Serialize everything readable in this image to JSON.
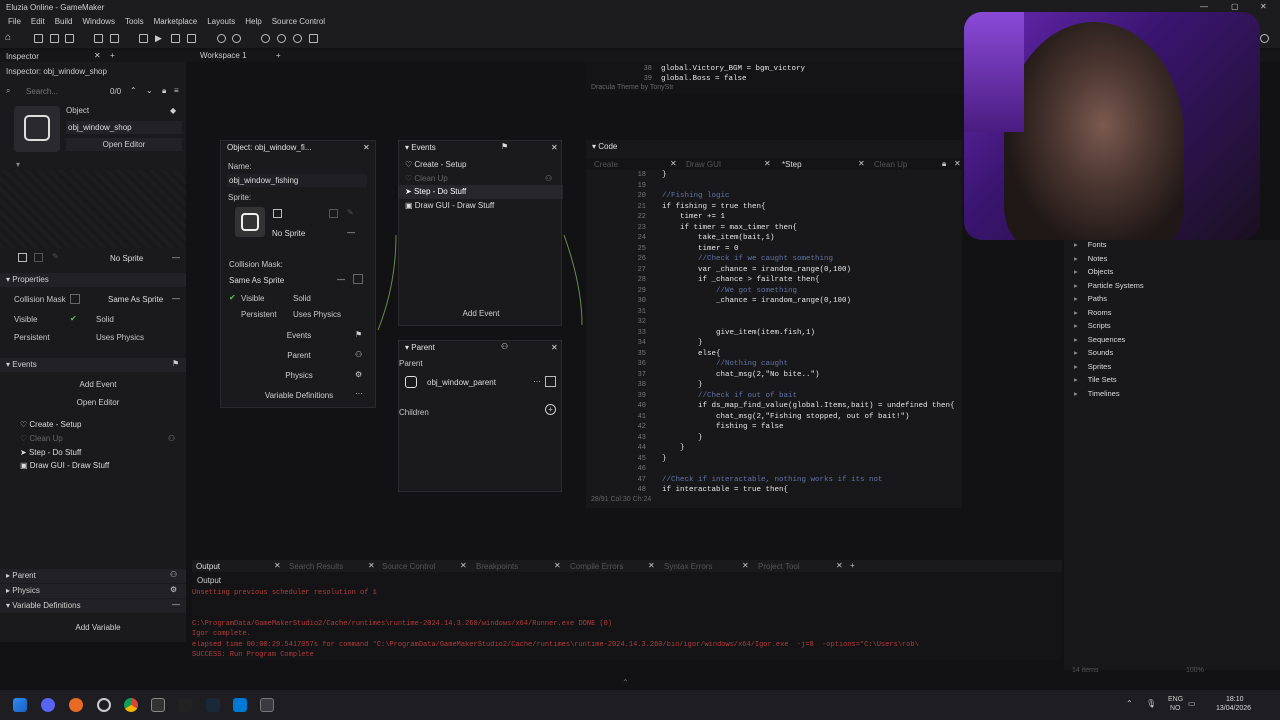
{
  "window": {
    "title": "Eluzia Online - GameMaker"
  },
  "menu": [
    "File",
    "Edit",
    "Build",
    "Windows",
    "Tools",
    "Marketplace",
    "Layouts",
    "Help",
    "Source Control"
  ],
  "workspace": {
    "tab": "Workspace 1",
    "add": "+"
  },
  "inspector": {
    "tab": "Inspector",
    "title": "Inspector: obj_window_shop",
    "search_placeholder": "Search...",
    "count": "0/0",
    "object_label": "Object",
    "object_name": "obj_window_shop",
    "open_editor": "Open Editor",
    "no_sprite": "No Sprite",
    "properties_header": "Properties",
    "collision_mask": "Collision Mask",
    "same_as_sprite": "Same As Sprite",
    "visible": "Visible",
    "solid": "Solid",
    "persistent": "Persistent",
    "uses_physics": "Uses Physics",
    "events_header": "Events",
    "add_event": "Add Event",
    "open_editor2": "Open Editor",
    "events": [
      "Create - Setup",
      "Clean Up",
      "Step - Do Stuff",
      "Draw GUI - Draw Stuff"
    ],
    "parent": "Parent",
    "physics": "Physics",
    "variable_definitions": "Variable Definitions",
    "add_variable": "Add Variable"
  },
  "object_window": {
    "title": "Object: obj_window_fi...",
    "name_label": "Name:",
    "name_value": "obj_window_fishing",
    "sprite_label": "Sprite:",
    "no_sprite": "No Sprite",
    "collision_mask": "Collision Mask:",
    "same_as_sprite": "Same As Sprite",
    "visible": "Visible",
    "solid": "Solid",
    "persistent": "Persistent",
    "uses_physics": "Uses Physics",
    "events_btn": "Events",
    "parent_btn": "Parent",
    "physics_btn": "Physics",
    "vardefs_btn": "Variable Definitions"
  },
  "events_window": {
    "title": "Events",
    "items": [
      "Create - Setup",
      "Clean Up",
      "Step - Do Stuff",
      "Draw GUI - Draw Stuff"
    ],
    "add_event": "Add Event"
  },
  "parent_window": {
    "title": "Parent",
    "label": "Parent",
    "value": "obj_window_parent",
    "children": "Children"
  },
  "top_code": {
    "lines": [
      {
        "n": "38",
        "t": "global.Victory_BGM = bgm_victory"
      },
      {
        "n": "39",
        "t": "global.Boss = false"
      }
    ],
    "theme": "Dracula Theme by TonyStr"
  },
  "code_window": {
    "title": "Code",
    "tabs": [
      "Create",
      "Draw GUI",
      "*Step",
      "Clean Up"
    ],
    "status": "28/91 Col:30 Ch:24",
    "lines": [
      {
        "n": "18",
        "t": "}"
      },
      {
        "n": "19",
        "t": ""
      },
      {
        "n": "20",
        "t": "//Fishing logic"
      },
      {
        "n": "21",
        "t": "if fishing = true then{"
      },
      {
        "n": "22",
        "t": "    timer += 1"
      },
      {
        "n": "23",
        "t": "    if timer = max_timer then{"
      },
      {
        "n": "24",
        "t": "        take_item(bait,1)"
      },
      {
        "n": "25",
        "t": "        timer = 0"
      },
      {
        "n": "26",
        "t": "        //Check if we caught something"
      },
      {
        "n": "27",
        "t": "        var _chance = irandom_range(0,100)"
      },
      {
        "n": "28",
        "t": "        if _chance > failrate then{"
      },
      {
        "n": "29",
        "t": "            //We got something"
      },
      {
        "n": "30",
        "t": "            _chance = irandom_range(0,100)"
      },
      {
        "n": "31",
        "t": ""
      },
      {
        "n": "32",
        "t": ""
      },
      {
        "n": "33",
        "t": "            give_item(item.fish,1)"
      },
      {
        "n": "34",
        "t": "        }"
      },
      {
        "n": "35",
        "t": "        else{"
      },
      {
        "n": "36",
        "t": "            //Nothing caught"
      },
      {
        "n": "37",
        "t": "            chat_msg(2,\"No bite..\")"
      },
      {
        "n": "38",
        "t": "        }"
      },
      {
        "n": "39",
        "t": "        //Check if out of bait"
      },
      {
        "n": "40",
        "t": "        if ds_map_find_value(global.Items,bait) = undefined then{"
      },
      {
        "n": "41",
        "t": "            chat_msg(2,\"Fishing stopped, out of bait!\")"
      },
      {
        "n": "42",
        "t": "            fishing = false"
      },
      {
        "n": "43",
        "t": "        }"
      },
      {
        "n": "44",
        "t": "    }"
      },
      {
        "n": "45",
        "t": "}"
      },
      {
        "n": "46",
        "t": ""
      },
      {
        "n": "47",
        "t": "//Check if interactable, nothing works if its not"
      },
      {
        "n": "48",
        "t": "if interactable = true then{"
      }
    ]
  },
  "asset_tree": [
    "Fonts",
    "Notes",
    "Objects",
    "Particle Systems",
    "Paths",
    "Rooms",
    "Scripts",
    "Sequences",
    "Sounds",
    "Sprites",
    "Tile Sets",
    "Timelines"
  ],
  "asset_footer": {
    "count": "14 items",
    "zoom": "100%"
  },
  "output": {
    "title": "Output",
    "tabs": [
      "Search Results",
      "Source Control",
      "Breakpoints",
      "Compile Errors",
      "Syntax Errors",
      "Project Tool"
    ],
    "sub": "Output",
    "lines": [
      "Unsetting previous scheduler resolution of 1",
      "",
      "C:\\ProgramData/GameMakerStudio2/Cache/runtimes\\runtime-2024.14.3.260/windows/x64/Runner.exe DONE (0)",
      "Igor complete.",
      "elapsed time 00:00:29.5417057s for command \"C:\\ProgramData/GameMakerStudio2/Cache/runtimes\\runtime-2024.14.3.260/bin/igor/windows/x64/Igor.exe  -j=8  -options=\"C:\\Users\\rob\\",
      "SUCCESS: Run Program Complete"
    ]
  },
  "taskbar": {
    "lang1": "ENG",
    "lang2": "NO",
    "time": "18:10",
    "date": "13/04/2026"
  }
}
